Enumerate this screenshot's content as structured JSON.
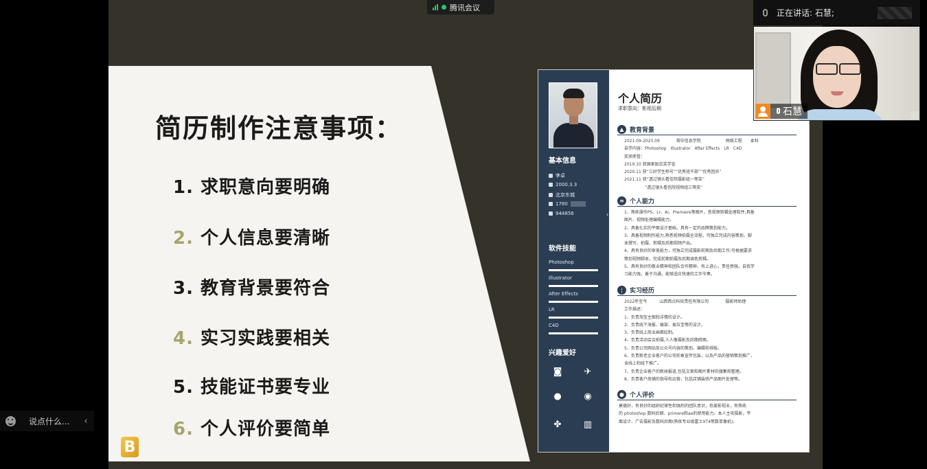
{
  "meeting": {
    "app_name": "腾讯会议"
  },
  "speaker": {
    "label": "正在讲话: 石慧;",
    "video_name": "石慧"
  },
  "chat": {
    "placeholder": "说点什么..."
  },
  "slide": {
    "title": "简历制作注意事项：",
    "points": [
      {
        "num": "1.",
        "text": "求职意向要明确",
        "num_color": "#1a1a1a"
      },
      {
        "num": "2.",
        "text": "个人信息要清晰",
        "num_color": "#a7a56a"
      },
      {
        "num": "3.",
        "text": "教育背景要符合",
        "num_color": "#1a1a1a"
      },
      {
        "num": "4.",
        "text": "实习实践要相关",
        "num_color": "#a7a56a"
      },
      {
        "num": "5.",
        "text": "技能证书要专业",
        "num_color": "#1a1a1a"
      },
      {
        "num": "6.",
        "text": "个人评价要简单",
        "num_color": "#a7a56a"
      }
    ]
  },
  "resume": {
    "title": "个人简历",
    "subtitle": "求职意向：影视后期",
    "sidebar": {
      "basic_heading": "基本信息",
      "info": [
        "李卓",
        "2000.3.3",
        "北京东城",
        "1780",
        "944856"
      ],
      "skills_heading": "软件技能",
      "skills": [
        "Photoshop",
        "Illustrator",
        "After Effects",
        "LR",
        "C4D"
      ],
      "hobbies_heading": "兴趣爱好"
    },
    "sections": [
      {
        "name": "教育背景",
        "lines": [
          "2021.09-2023.09　　　　首中信息学院　　　　　　网络工程　　本科",
          "自学内容：Photoshop　Illustrator　After Effects　LR　C4D",
          "奖项荣誉：",
          "2019.10  获国家励志奖学金",
          "2020.11  获“三好学生称号”“优秀班干部”“优秀团员”",
          "2021.11  获“透过镜头看信院摄影组一等奖”",
          "　　　　　“透过镜头看信院视频组三等奖”"
        ]
      },
      {
        "name": "个人能力",
        "lines": [
          "1、熟练操作PS、Lr、Ai、Premiere等图片，音视频剪辑处理软件;具备",
          "图片、视频处理编辑能力。",
          "2、具备扎实的平面设计基础，具有一定的品牌策划能力。",
          "3、具备视频制作能力,熟悉视频拍摄全流程。可独立完成内容策划、脚",
          "本撰写、拍摄、剪辑及后期视频产出。",
          "4、具有良好的审美能力，可独立完成摄影前期及后期工作;可根据要求",
          "策划视频脚本，完成前期拍摄及后期调色剪辑。",
          "5、具有良好的敬业精神和团队合作精神，有上进心，责任感强，自我学",
          "习能力强，善于沟通，能够适应快速的工作节奏。"
        ]
      },
      {
        "name": "实习经历",
        "lines": [
          "2022年至今　　　山西西点科技责任有限公司　　　　摄影师助理",
          "工作描述：",
          "1、负责淘宝主图和详情的设计。",
          "2、负责线下海报、展架、易拉宝等的设计。",
          "3、负责线上商业画面绘制。",
          "4、负责活动会议拍摄,人人像摄影及后期修图。",
          "5、负责公司网站及公众号内容的策划、编辑和排版。",
          "6、负责新老企业客户的公司形象宣传包装，以及产品的营销策划推广，",
          "含线上和线下推广。",
          "7、负责企业客户的新闻报道,包括文案和图片素材的搜集和整理。",
          "8、负责客户商铺的指导和运营，包括店铺装修产品图片处理等。"
        ]
      },
      {
        "name": "个人评价",
        "lines": [
          "莫德好，有良好的组织纪律性和强烈的团队意识，热爱影视业，有熟练",
          "的 photoshop 数码后期、primere和ae的使用能力。本人主攻摄影，平",
          "面设计、广告摄影及数码后期(熟练专业级富士XT4等数单像机)。"
        ]
      }
    ]
  },
  "colors": {
    "slide_bg": "#35322a",
    "resume_sidebar": "#2b3d52",
    "accent_olive": "#a7a56a",
    "meeting_green": "#2cc66b"
  },
  "icons": [
    "signal-icon",
    "recording-dot-icon",
    "mic-icon",
    "emoji-icon",
    "collapse-chevron-icon",
    "user-avatar-icon",
    "camera-icon",
    "badminton-icon",
    "basketball-icon",
    "football-icon",
    "book-icon",
    "graduation-cap-icon",
    "layers-icon",
    "thermometer-icon",
    "person-icon"
  ]
}
